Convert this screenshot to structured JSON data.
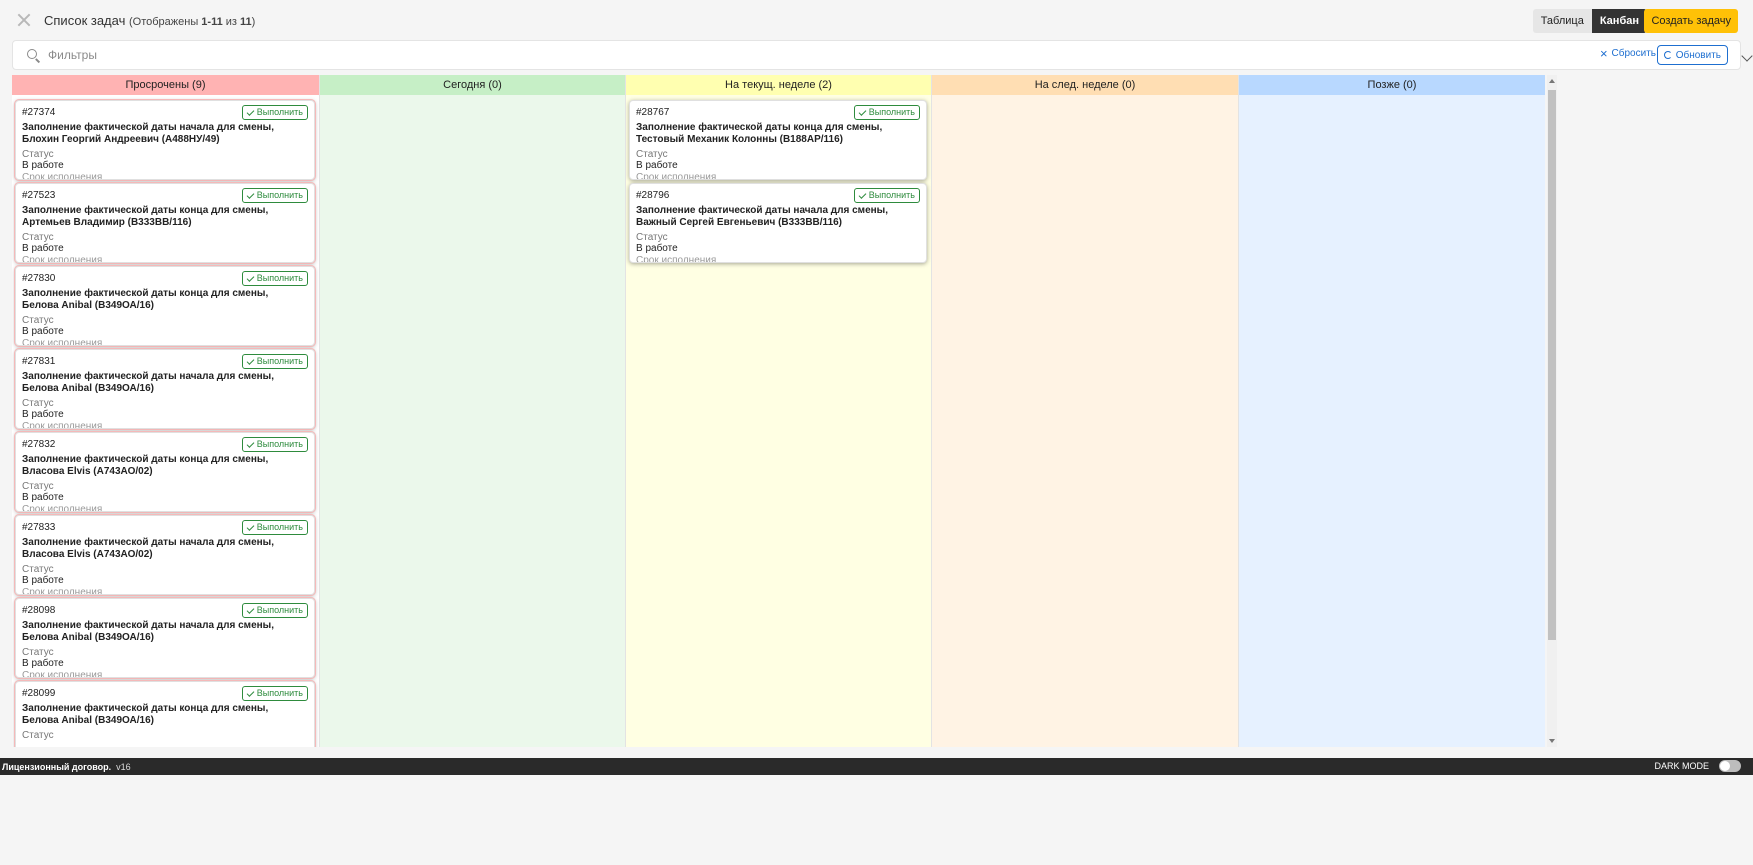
{
  "header": {
    "title": "Список задач",
    "subtitle_prefix": "(Отображены ",
    "subtitle_range": "1-11",
    "subtitle_mid": " из ",
    "subtitle_total": "11",
    "subtitle_suffix": ")",
    "view_table": "Таблица",
    "view_kanban": "Канбан",
    "create_task": "Создать задачу"
  },
  "filters": {
    "placeholder": "Фильтры",
    "reset": "Сбросить",
    "refresh": "Обновить"
  },
  "colors": {
    "overdue_head": "#ffb3b3",
    "overdue_body": "#ffffff",
    "today_head": "#c6efc6",
    "today_body": "#ebf8eb",
    "this_week_head": "#ffffb0",
    "this_week_body": "#ffffe3",
    "next_week_head": "#ffdeb3",
    "next_week_body": "#fff3e4",
    "later_head": "#b8d8ff",
    "later_body": "#e6f1ff"
  },
  "columns": [
    {
      "key": "overdue",
      "title": "Просрочены (9)",
      "cards": [
        {
          "num": "#27374",
          "name": "Заполнение фактической даты начала для смены, Блохин Георгий Андреевич (А488НУ/49)",
          "status_label": "Статус",
          "status": "В работе",
          "due_label": "Срок исполнения",
          "action": "Выполнить"
        },
        {
          "num": "#27523",
          "name": "Заполнение фактической даты конца для смены, Артемьев Владимир (В333ВВ/116)",
          "status_label": "Статус",
          "status": "В работе",
          "due_label": "Срок исполнения",
          "action": "Выполнить"
        },
        {
          "num": "#27830",
          "name": "Заполнение фактической даты конца для смены, Белова Anibal (В349ОА/16)",
          "status_label": "Статус",
          "status": "В работе",
          "due_label": "Срок исполнения",
          "action": "Выполнить"
        },
        {
          "num": "#27831",
          "name": "Заполнение фактической даты начала для смены, Белова Anibal (В349ОА/16)",
          "status_label": "Статус",
          "status": "В работе",
          "due_label": "Срок исполнения",
          "action": "Выполнить"
        },
        {
          "num": "#27832",
          "name": "Заполнение фактической даты конца для смены, Власова Elvis (А743АО/02)",
          "status_label": "Статус",
          "status": "В работе",
          "due_label": "Срок исполнения",
          "action": "Выполнить"
        },
        {
          "num": "#27833",
          "name": "Заполнение фактической даты начала для смены, Власова Elvis (А743АО/02)",
          "status_label": "Статус",
          "status": "В работе",
          "due_label": "Срок исполнения",
          "action": "Выполнить"
        },
        {
          "num": "#28098",
          "name": "Заполнение фактической даты начала для смены, Белова Anibal (В349ОА/16)",
          "status_label": "Статус",
          "status": "В работе",
          "due_label": "Срок исполнения",
          "action": "Выполнить"
        },
        {
          "num": "#28099",
          "name": "Заполнение фактической даты конца для смены, Белова Anibal (В349ОА/16)",
          "status_label": "Статус",
          "status": "",
          "due_label": "",
          "action": "Выполнить"
        }
      ]
    },
    {
      "key": "today",
      "title": "Сегодня (0)",
      "cards": []
    },
    {
      "key": "this_week",
      "title": "На текущ. неделе (2)",
      "cards": [
        {
          "num": "#28767",
          "name": "Заполнение фактической даты конца для смены, Тестовый Механик Колонны (В188АР/116)",
          "status_label": "Статус",
          "status": "В работе",
          "due_label": "Срок исполнения",
          "action": "Выполнить"
        },
        {
          "num": "#28796",
          "name": "Заполнение фактической даты начала для смены, Важный Сергей Евгеньевич (В333ВВ/116)",
          "status_label": "Статус",
          "status": "В работе",
          "due_label": "Срок исполнения",
          "action": "Выполнить"
        }
      ]
    },
    {
      "key": "next_week",
      "title": "На след. неделе (0)",
      "cards": []
    },
    {
      "key": "later",
      "title": "Позже (0)",
      "cards": []
    }
  ],
  "footer": {
    "license": "Лицензионный договор.",
    "version": "v16",
    "dark_mode": "DARK MODE"
  }
}
